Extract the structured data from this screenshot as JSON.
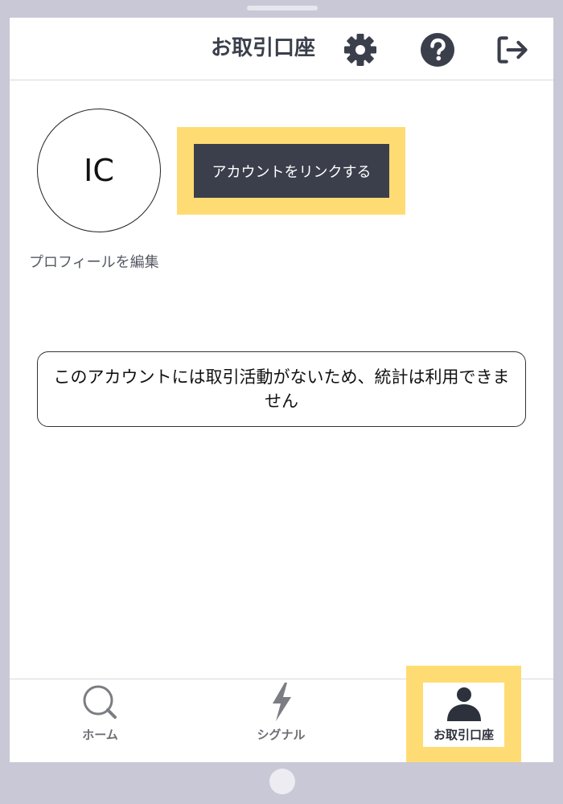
{
  "header": {
    "title": "お取引口座",
    "icons": [
      "gear-icon",
      "help-icon",
      "logout-icon"
    ]
  },
  "profile": {
    "initials": "IC",
    "edit_label": "プロフィールを編集",
    "link_button_label": "アカウントをリンクする"
  },
  "notice": {
    "text": "このアカウントには取引活動がないため、統計は利用できません"
  },
  "tabs": [
    {
      "label": "ホーム",
      "icon": "search-icon"
    },
    {
      "label": "シグナル",
      "icon": "lightning-icon"
    },
    {
      "label": "お取引口座",
      "icon": "person-icon",
      "selected": true
    }
  ],
  "colors": {
    "highlight": "#ffdc73",
    "dark": "#3b3f4c",
    "frame": "#c9c8d6"
  }
}
